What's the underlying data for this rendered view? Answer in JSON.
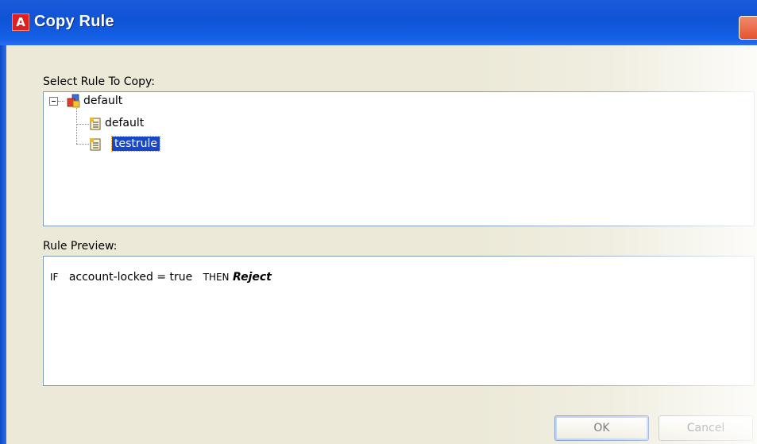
{
  "window": {
    "title": "Copy Rule",
    "app_icon": "adobe-a-icon",
    "app_icon_glyph": "A"
  },
  "select_rule": {
    "label": "Select Rule To Copy:",
    "tree": {
      "root": {
        "label": "default",
        "icon": "database-group-icon",
        "expanded": true
      },
      "children": [
        {
          "label": "default",
          "icon": "rule-document-icon",
          "selected": false
        },
        {
          "label": "testrule",
          "icon": "rule-document-icon",
          "selected": true
        }
      ]
    }
  },
  "rule_preview": {
    "label": "Rule Preview:",
    "if_keyword": "IF",
    "condition": "account-locked = true",
    "then_keyword": "THEN",
    "action": "Reject"
  },
  "buttons": {
    "ok": "OK",
    "cancel": "Cancel"
  },
  "colors": {
    "titlebar": "#0f53d6",
    "selection": "#1846c8",
    "panel_border": "#7f9db9"
  }
}
